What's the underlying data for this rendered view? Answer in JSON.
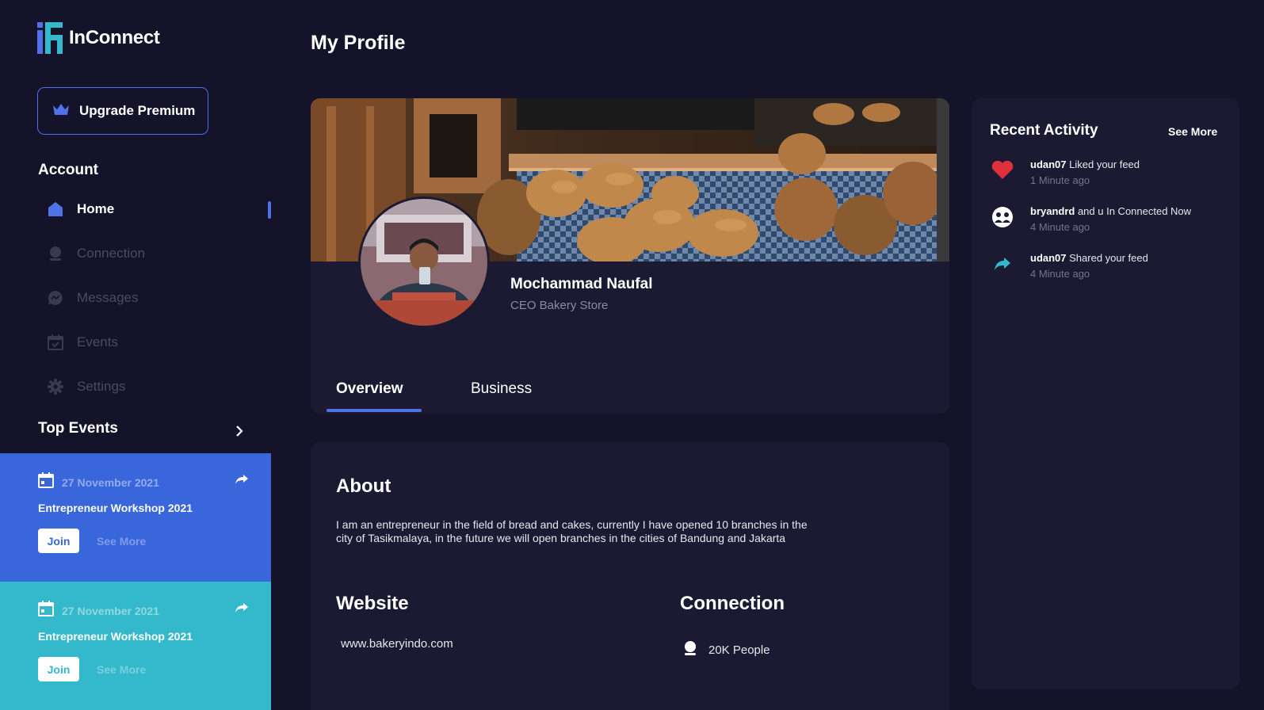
{
  "app": {
    "name": "InConnect"
  },
  "sidebar": {
    "premium_label": "Upgrade Premium",
    "account_title": "Account",
    "nav": [
      {
        "label": "Home",
        "icon": "home-icon",
        "active": true
      },
      {
        "label": "Connection",
        "icon": "user-icon"
      },
      {
        "label": "Messages",
        "icon": "chat-icon"
      },
      {
        "label": "Events",
        "icon": "calendar-check-icon"
      },
      {
        "label": "Settings",
        "icon": "gear-icon"
      }
    ],
    "top_events_title": "Top Events",
    "events": [
      {
        "date": "27 November 2021",
        "title": "Entrepreneur Workshop 2021",
        "join_label": "Join",
        "more_label": "See More",
        "color": "#3a66dc"
      },
      {
        "date": "27 November 2021",
        "title": "Entrepreneur Workshop 2021",
        "join_label": "Join",
        "more_label": "See More",
        "color": "#34b8cc"
      }
    ]
  },
  "main": {
    "page_title": "My Profile",
    "profile": {
      "name": "Mochammad Naufal",
      "role": "CEO Bakery Store"
    },
    "tabs": [
      {
        "label": "Overview",
        "active": true
      },
      {
        "label": "Business"
      }
    ],
    "about": {
      "title": "About",
      "text": "I am an entrepreneur in the field of bread and cakes, currently I have opened 10 branches in the city of Tasikmalaya, in the future we will open branches in the cities of Bandung and Jakarta"
    },
    "website": {
      "title": "Website",
      "value": "www.bakeryindo.com"
    },
    "connection": {
      "title": "Connection",
      "value": "20K People"
    }
  },
  "activity": {
    "title": "Recent Activity",
    "more_label": "See More",
    "items": [
      {
        "user": "udan07",
        "text": " Liked your feed",
        "time": "1 Minute ago",
        "icon": "heart-icon"
      },
      {
        "user": "bryandrd",
        "text": " and u In Connected Now",
        "time": "4 Minute ago",
        "icon": "people-icon"
      },
      {
        "user": "udan07",
        "text": " Shared your feed",
        "time": "4 Minute ago",
        "icon": "share-icon"
      }
    ]
  },
  "colors": {
    "background": "#15132a",
    "card": "#1c1a33",
    "accent": "#4f72e8",
    "event_blue": "#3a66dc",
    "event_teal": "#34b8cc",
    "heart": "#e0303c"
  }
}
